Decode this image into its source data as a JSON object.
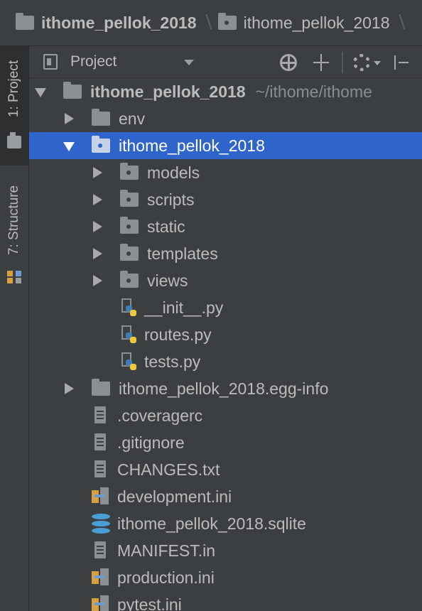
{
  "breadcrumb": {
    "items": [
      {
        "label": "ithome_pellok_2018"
      },
      {
        "label": "ithome_pellok_2018"
      }
    ]
  },
  "tool_strip": {
    "project_tab": "1: Project",
    "structure_tab": "7: Structure"
  },
  "panel": {
    "view_label": "Project"
  },
  "tree": {
    "root": {
      "label": "ithome_pellok_2018",
      "path": "~/ithome/ithome"
    },
    "rows": [
      {
        "label": "env"
      },
      {
        "label": "ithome_pellok_2018"
      },
      {
        "label": "models"
      },
      {
        "label": "scripts"
      },
      {
        "label": "static"
      },
      {
        "label": "templates"
      },
      {
        "label": "views"
      },
      {
        "label": "__init__.py"
      },
      {
        "label": "routes.py"
      },
      {
        "label": "tests.py"
      },
      {
        "label": "ithome_pellok_2018.egg-info"
      },
      {
        "label": ".coveragerc"
      },
      {
        "label": ".gitignore"
      },
      {
        "label": "CHANGES.txt"
      },
      {
        "label": "development.ini"
      },
      {
        "label": "ithome_pellok_2018.sqlite"
      },
      {
        "label": "MANIFEST.in"
      },
      {
        "label": "production.ini"
      },
      {
        "label": "pytest.ini"
      }
    ]
  },
  "colors": {
    "background": "#3c3f41",
    "selection": "#2f65ca",
    "text": "#bbbbbb"
  }
}
